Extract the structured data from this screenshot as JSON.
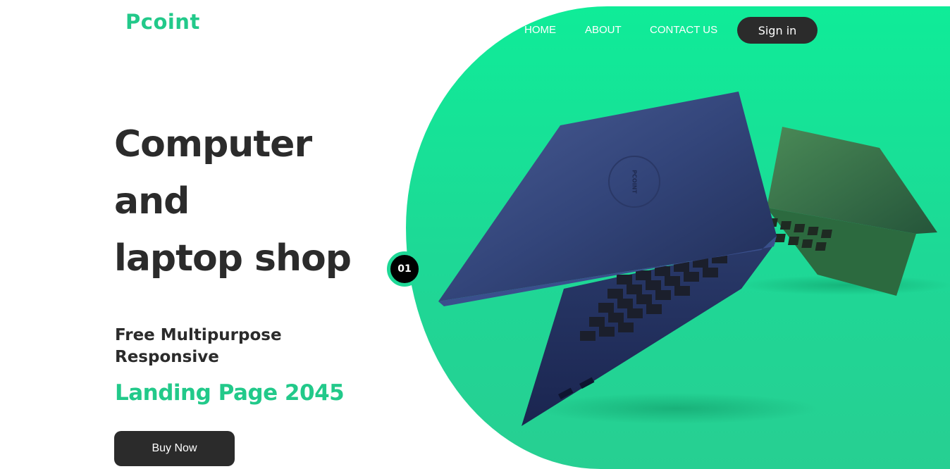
{
  "brand": {
    "logo_text": "Pcoint"
  },
  "nav": {
    "items": [
      {
        "label": "HOME"
      },
      {
        "label": "ABOUT"
      },
      {
        "label": "CONTACT US"
      }
    ],
    "signin_label": "Sign in"
  },
  "hero": {
    "title_lines": [
      "Computer",
      "and",
      "laptop shop"
    ],
    "subtitle_lines": [
      "Free Multipurpose",
      "Responsive"
    ],
    "highlight": "Landing Page 2045",
    "cta_label": "Buy Now",
    "slide_number": "01",
    "laptop_lid_logo": "PCOINT"
  },
  "colors": {
    "accent": "#22c98a",
    "hero_green": "#0fec98",
    "dark": "#2b2b2b",
    "laptop_blue": "#2c3a6b",
    "laptop_green": "#2f6b3f"
  }
}
